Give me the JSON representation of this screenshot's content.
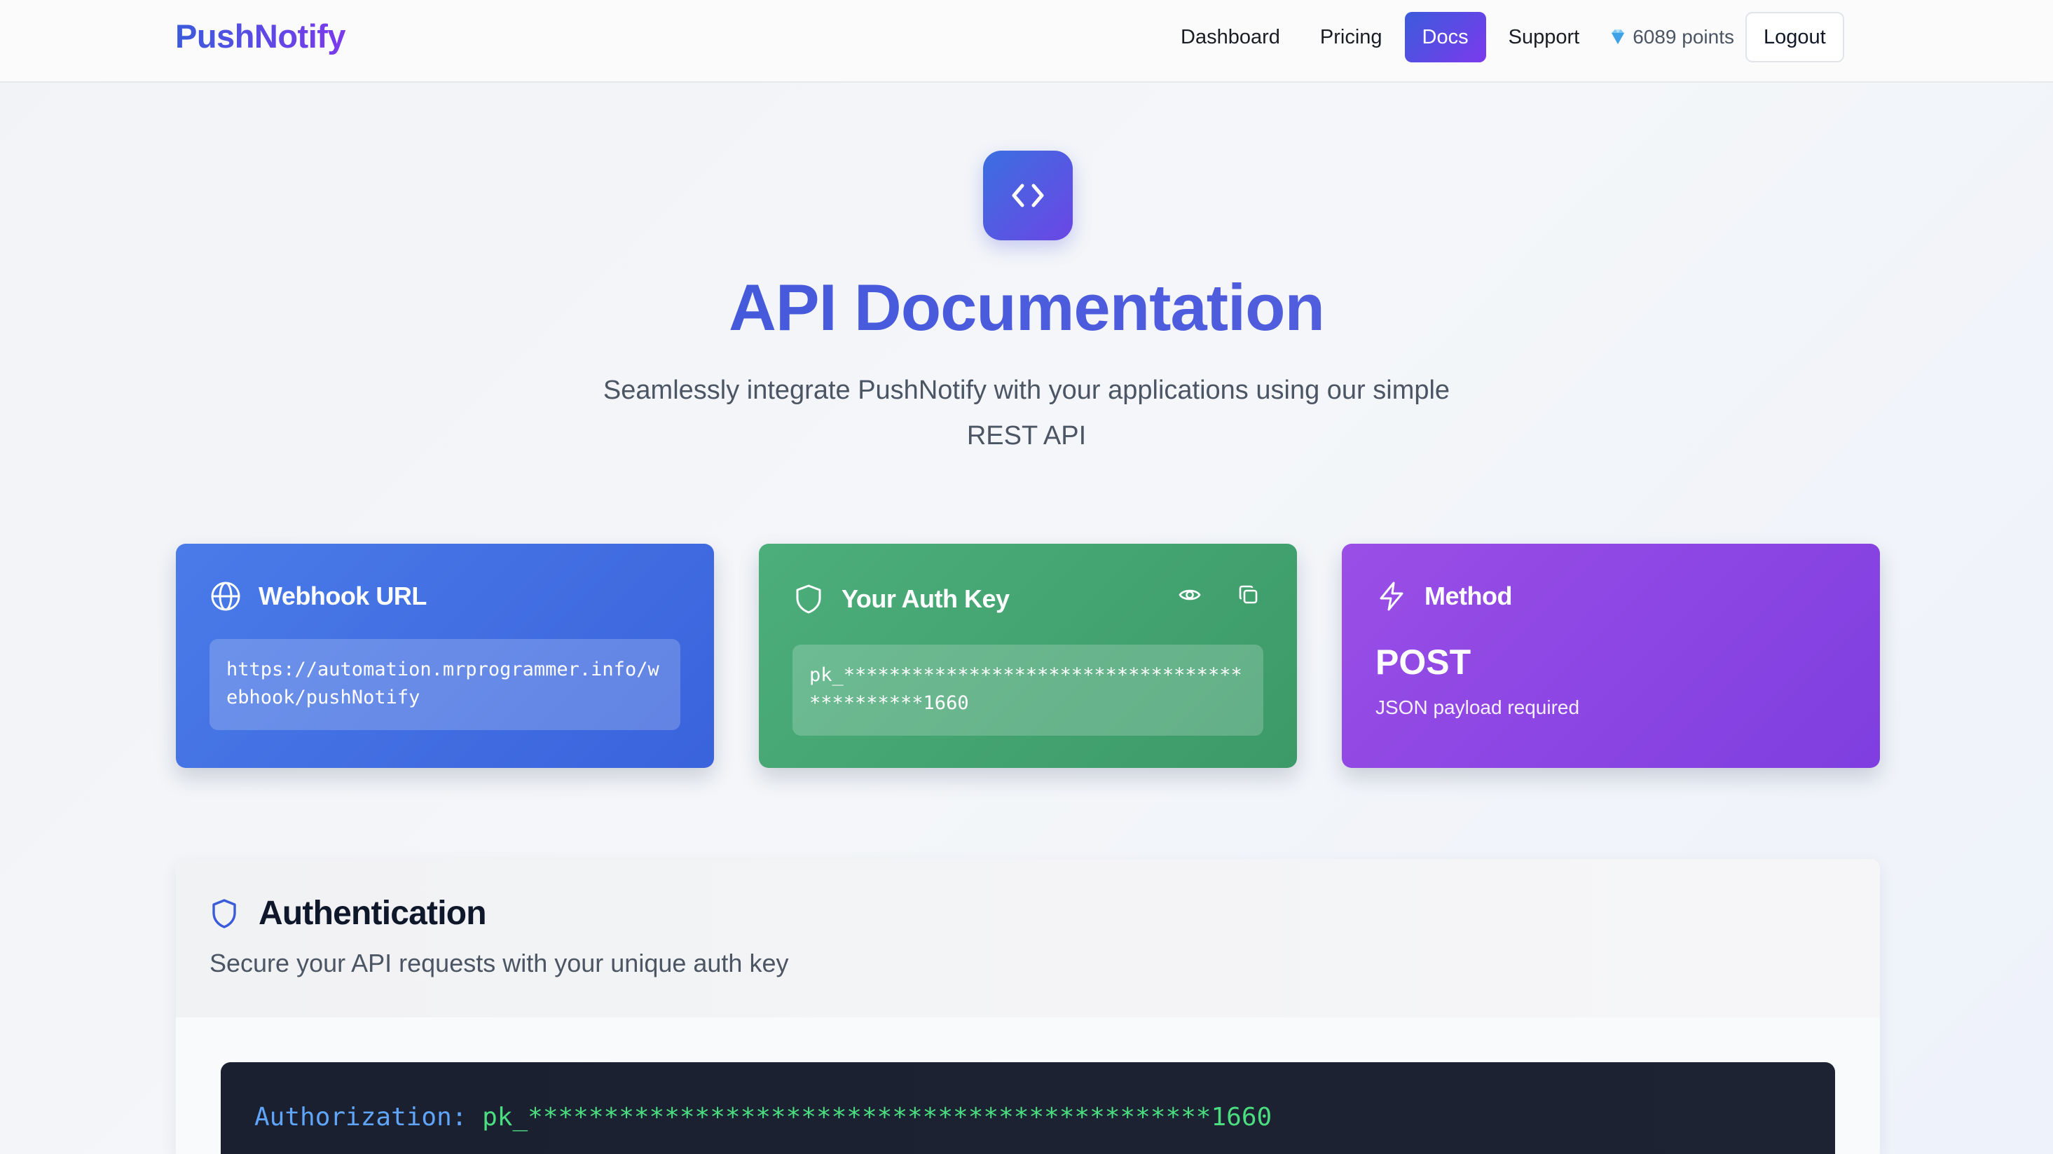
{
  "brand": "PushNotify",
  "nav": {
    "links": [
      "Dashboard",
      "Pricing",
      "Docs",
      "Support"
    ],
    "active": "Docs",
    "points": "6089 points",
    "logout": "Logout"
  },
  "hero": {
    "icon": "code-brackets-icon",
    "title": "API Documentation",
    "subtitle": "Seamlessly integrate PushNotify with your applications using our simple REST API"
  },
  "cards": {
    "webhook": {
      "title": "Webhook URL",
      "icon": "globe-icon",
      "url": "https://automation.mrprogrammer.info/webhook/pushNotify"
    },
    "auth_key": {
      "title": "Your Auth Key",
      "icon": "shield-icon",
      "value": "pk_*********************************************1660"
    },
    "method": {
      "title": "Method",
      "icon": "lightning-icon",
      "value": "POST",
      "note": "JSON payload required"
    }
  },
  "authentication": {
    "title": "Authentication",
    "description": "Secure your API requests with your unique auth key",
    "code_key": "Authorization:",
    "code_value": "pk_*********************************************1660"
  },
  "colors": {
    "primary": "#3b5bdb",
    "accent": "#7c3aed",
    "card_blue": "#4a7be8",
    "card_green": "#4cae7b",
    "card_purple": "#8f47e4"
  }
}
